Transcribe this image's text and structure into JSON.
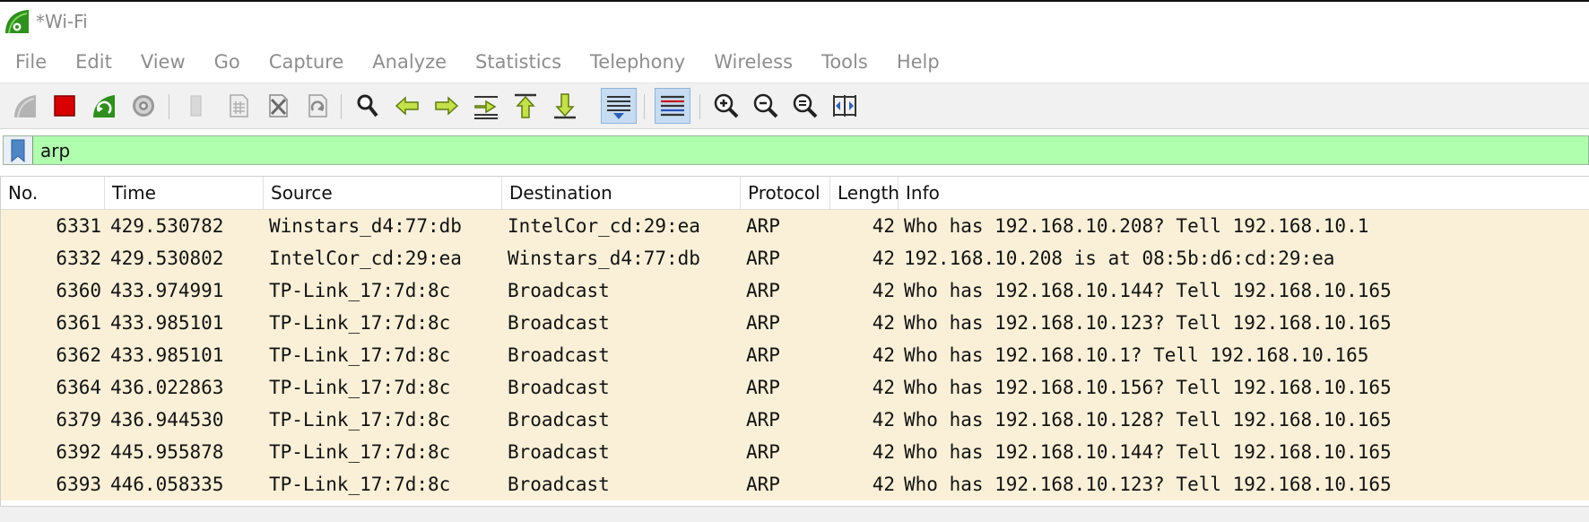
{
  "window": {
    "title": "*Wi-Fi"
  },
  "menu": [
    "File",
    "Edit",
    "View",
    "Go",
    "Capture",
    "Analyze",
    "Statistics",
    "Telephony",
    "Wireless",
    "Tools",
    "Help"
  ],
  "toolbar": {
    "icons": [
      "start-capture-icon",
      "stop-capture-icon",
      "restart-capture-icon",
      "capture-options-icon",
      "open-file-icon",
      "save-file-icon",
      "close-file-icon",
      "reload-file-icon",
      "find-packet-icon",
      "go-back-icon",
      "go-forward-icon",
      "go-to-packet-icon",
      "first-packet-icon",
      "last-packet-icon",
      "auto-scroll-icon",
      "colorize-icon",
      "zoom-in-icon",
      "zoom-out-icon",
      "normal-size-icon",
      "resize-columns-icon"
    ]
  },
  "filter": {
    "value": "arp"
  },
  "columns": [
    "No.",
    "Time",
    "Source",
    "Destination",
    "Protocol",
    "Length",
    "Info"
  ],
  "rows": [
    [
      "6331",
      "429.530782",
      "Winstars_d4:77:db",
      "IntelCor_cd:29:ea",
      "ARP",
      "42",
      "Who has 192.168.10.208? Tell 192.168.10.1"
    ],
    [
      "6332",
      "429.530802",
      "IntelCor_cd:29:ea",
      "Winstars_d4:77:db",
      "ARP",
      "42",
      "192.168.10.208 is at 08:5b:d6:cd:29:ea"
    ],
    [
      "6360",
      "433.974991",
      "TP-Link_17:7d:8c",
      "Broadcast",
      "ARP",
      "42",
      "Who has 192.168.10.144? Tell 192.168.10.165"
    ],
    [
      "6361",
      "433.985101",
      "TP-Link_17:7d:8c",
      "Broadcast",
      "ARP",
      "42",
      "Who has 192.168.10.123? Tell 192.168.10.165"
    ],
    [
      "6362",
      "433.985101",
      "TP-Link_17:7d:8c",
      "Broadcast",
      "ARP",
      "42",
      "Who has 192.168.10.1? Tell 192.168.10.165"
    ],
    [
      "6364",
      "436.022863",
      "TP-Link_17:7d:8c",
      "Broadcast",
      "ARP",
      "42",
      "Who has 192.168.10.156? Tell 192.168.10.165"
    ],
    [
      "6379",
      "436.944530",
      "TP-Link_17:7d:8c",
      "Broadcast",
      "ARP",
      "42",
      "Who has 192.168.10.128? Tell 192.168.10.165"
    ],
    [
      "6392",
      "445.955878",
      "TP-Link_17:7d:8c",
      "Broadcast",
      "ARP",
      "42",
      "Who has 192.168.10.144? Tell 192.168.10.165"
    ],
    [
      "6393",
      "446.058335",
      "TP-Link_17:7d:8c",
      "Broadcast",
      "ARP",
      "42",
      "Who has 192.168.10.123? Tell 192.168.10.165"
    ]
  ],
  "colors": {
    "filter_valid_bg": "#afffaf",
    "row_bg": "#faf0d7",
    "toolbar_bg": "#f1f1f1",
    "active_toggle_bg": "#c6dcf2"
  }
}
